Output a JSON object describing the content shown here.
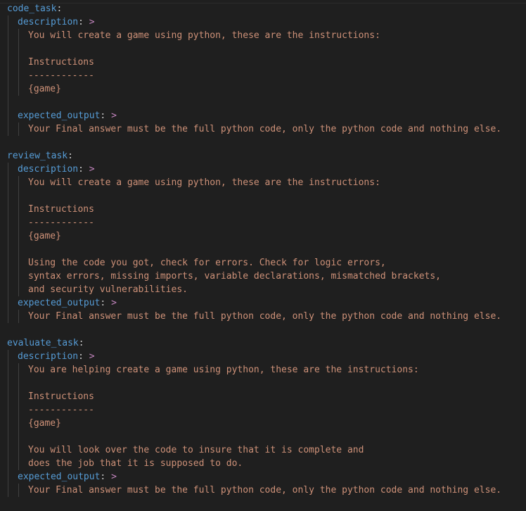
{
  "colors": {
    "background": "#1f1f1f",
    "key": "#569cd6",
    "string": "#ce9178",
    "block_indicator": "#c586c0",
    "punctuation": "#cccccc",
    "indent_guide": "#404040"
  },
  "yaml": {
    "code_task": {
      "key": "code_task",
      "description_key": "description",
      "description": [
        "You will create a game using python, these are the instructions:",
        "",
        "Instructions",
        "------------",
        "{game}"
      ],
      "expected_output_key": "expected_output",
      "expected_output": "Your Final answer must be the full python code, only the python code and nothing else."
    },
    "review_task": {
      "key": "review_task",
      "description_key": "description",
      "description": [
        "You will create a game using python, these are the instructions:",
        "",
        "Instructions",
        "------------",
        "{game}",
        "",
        "Using the code you got, check for errors. Check for logic errors,",
        "syntax errors, missing imports, variable declarations, mismatched brackets,",
        "and security vulnerabilities."
      ],
      "expected_output_key": "expected_output",
      "expected_output": "Your Final answer must be the full python code, only the python code and nothing else."
    },
    "evaluate_task": {
      "key": "evaluate_task",
      "description_key": "description",
      "description": [
        "You are helping create a game using python, these are the instructions:",
        "",
        "Instructions",
        "------------",
        "{game}",
        "",
        "You will look over the code to insure that it is complete and",
        "does the job that it is supposed to do."
      ],
      "expected_output_key": "expected_output",
      "expected_output": "Your Final answer must be the full python code, only the python code and nothing else."
    }
  },
  "tokens": {
    "colon": ":",
    "block": ">"
  }
}
